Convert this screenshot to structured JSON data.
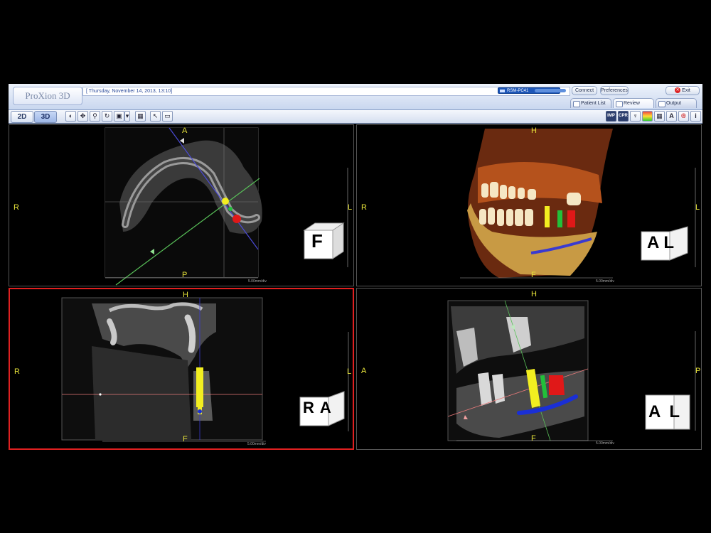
{
  "app": {
    "logo": "ProXion 3D",
    "datetime": "[ Thursday, November 14, 2013, 13:10]",
    "workstation": "RSM-PC41",
    "connect_label": "Connect",
    "preferences_label": "Preferences",
    "exit_label": "Exit",
    "tabs": [
      {
        "label": "Patient List"
      },
      {
        "label": "Review"
      },
      {
        "label": "Output"
      }
    ]
  },
  "toolbar": {
    "mode_2d": "2D",
    "mode_3d": "3D",
    "right_buttons": [
      "IMP",
      "CPR"
    ],
    "a_button": "A",
    "info_button": "i"
  },
  "views": {
    "axial": {
      "top": "A",
      "bottom": "P",
      "left": "R",
      "right": "L",
      "scale": "5.00mm/div",
      "cube": "F"
    },
    "volume": {
      "top": "H",
      "bottom": "F",
      "left": "R",
      "right": "L",
      "scale": "5.00mm/div",
      "cube": "AL"
    },
    "coronal": {
      "top": "H",
      "bottom": "F",
      "left": "R",
      "right": "L",
      "scale": "5.00mm/div",
      "cube": "RA"
    },
    "sagittal": {
      "top": "H",
      "bottom": "F",
      "left": "A",
      "right": "P",
      "scale": "5.00mm/div",
      "cube": "AL"
    }
  },
  "colors": {
    "accent": "#e6e23a",
    "implant_yellow": "#f2ee20",
    "implant_green": "#22c03a",
    "implant_red": "#e01818",
    "nerve_blue": "#1a2fd6",
    "selected_border": "#e02020"
  }
}
